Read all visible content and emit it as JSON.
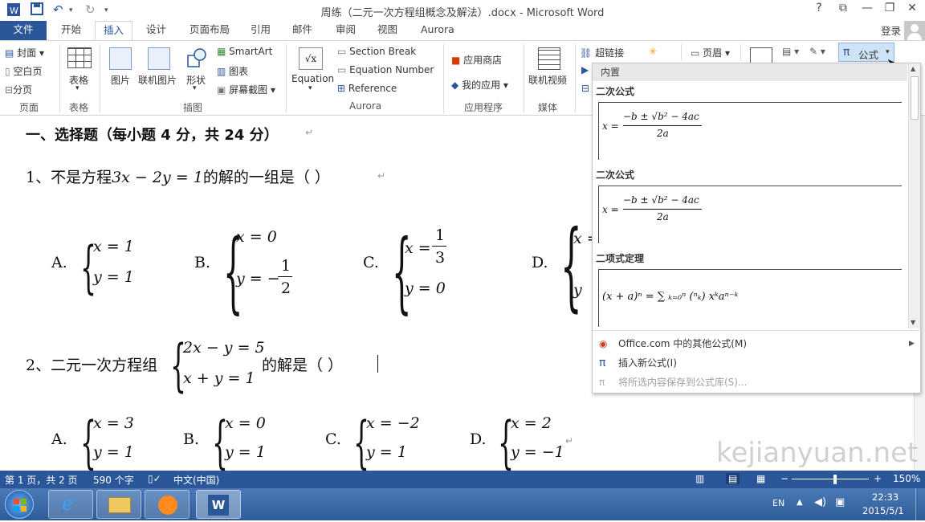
{
  "window": {
    "title": "周练（二元一次方程组概念及解法）.docx - Microsoft Word",
    "help": "?",
    "restore": "⧉",
    "minimize": "—",
    "maximize": "❐",
    "close": "✕"
  },
  "tabs": {
    "file": "文件",
    "items": [
      "开始",
      "插入",
      "设计",
      "页面布局",
      "引用",
      "邮件",
      "审阅",
      "视图",
      "Aurora"
    ],
    "login": "登录"
  },
  "ribbon": {
    "pages": {
      "cover": "封面",
      "blank": "空白页",
      "break": "分页",
      "group": "页面"
    },
    "table": {
      "label": "表格",
      "group": "表格"
    },
    "illustrations": {
      "picture": "图片",
      "online_picture": "联机图片",
      "shapes": "形状",
      "smartart": "SmartArt",
      "chart": "图表",
      "screenshot": "屏幕截图",
      "group": "插图"
    },
    "aurora": {
      "equation": "Equation",
      "section_break": "Section Break",
      "equation_number": "Equation Number",
      "reference": "Reference",
      "group": "Aurora"
    },
    "apps": {
      "store": "应用商店",
      "my_apps": "我的应用",
      "group": "应用程序"
    },
    "media": {
      "online_video": "联机视频",
      "group": "媒体"
    },
    "links": {
      "hyperlink": "超链接"
    },
    "header": {
      "label": "页眉"
    },
    "equation_button": {
      "symbol": "π",
      "label": "公式"
    }
  },
  "document": {
    "heading": "一、选择题（每小题 4 分，共 24 分）",
    "q1": {
      "prefix": "1、不是方程",
      "equation": "3x − 2y = 1",
      "suffix": "的解的一组是（        ）"
    },
    "q1_options": [
      {
        "label": "A.",
        "line1": "x = 1",
        "line2": "y = 1"
      },
      {
        "label": "B.",
        "line1": "x = 0",
        "line2": "y = −",
        "frac_num": "1",
        "frac_den": "2"
      },
      {
        "label": "C.",
        "line1": "x = ",
        "frac_num": "1",
        "frac_den": "3",
        "line2": "y = 0"
      },
      {
        "label": "D.",
        "line1": "x =",
        "line2": "y"
      }
    ],
    "q2": {
      "prefix": "2、二元一次方程组",
      "line1": "2x − y = 5",
      "line2": "x + y = 1",
      "suffix": "的解是（        ）"
    },
    "q2_options": [
      {
        "label": "A.",
        "line1": "x = 3",
        "line2": "y = 1"
      },
      {
        "label": "B.",
        "line1": "x = 0",
        "line2": "y = 1"
      },
      {
        "label": "C.",
        "line1": "x = −2",
        "line2": "y = 1"
      },
      {
        "label": "D.",
        "line1": "x = 2",
        "line2": "y = −1"
      }
    ]
  },
  "equation_gallery": {
    "header": "内置",
    "items": [
      {
        "title": "二次公式",
        "lhs": "x =",
        "numerator": "−b ± √b² − 4ac",
        "denominator": "2a"
      },
      {
        "title": "二次公式",
        "lhs": "x =",
        "numerator": "−b ± √b² − 4ac",
        "denominator": "2a"
      },
      {
        "title": "二项式定理",
        "formula": "(x + a)ⁿ = ∑ ₖ₌₀ⁿ (ⁿₖ) xᵏaⁿ⁻ᵏ"
      }
    ],
    "menu": [
      {
        "label": "Office.com 中的其他公式(M)",
        "enabled": true
      },
      {
        "label": "插入新公式(I)",
        "enabled": true
      },
      {
        "label": "将所选内容保存到公式库(S)...",
        "enabled": false
      }
    ]
  },
  "statusbar": {
    "page": "第 1 页，共 2 页",
    "words": "590 个字",
    "language": "中文(中国)",
    "zoom": "150%",
    "zoom_minus": "−",
    "zoom_plus": "+"
  },
  "taskbar": {
    "lang": "EN",
    "time": "22:33",
    "date": "2015/5/1"
  },
  "watermark": "kejianyuan.net",
  "colors": {
    "accent": "#2b579a",
    "taskbar": "#2e5c99"
  }
}
